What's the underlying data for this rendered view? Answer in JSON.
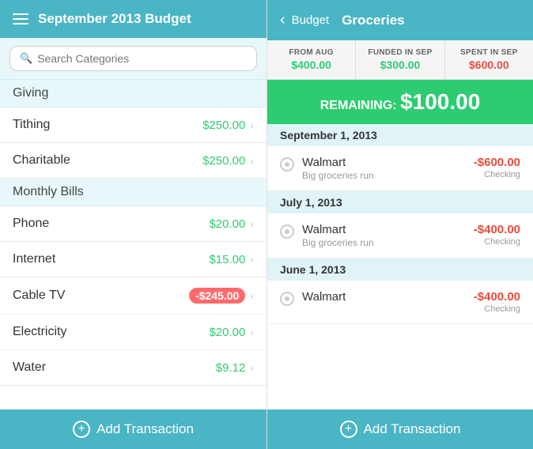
{
  "left": {
    "header": {
      "title": "September 2013 Budget"
    },
    "search": {
      "placeholder": "Search Categories"
    },
    "sections": [
      {
        "name": "Giving",
        "items": [
          {
            "label": "Tithing",
            "amount": "$250.00",
            "negative": false
          },
          {
            "label": "Charitable",
            "amount": "$250.00",
            "negative": false
          }
        ]
      },
      {
        "name": "Monthly Bills",
        "items": [
          {
            "label": "Phone",
            "amount": "$20.00",
            "negative": false
          },
          {
            "label": "Internet",
            "amount": "$15.00",
            "negative": false
          },
          {
            "label": "Cable TV",
            "amount": "-$245.00",
            "negative": true
          },
          {
            "label": "Electricity",
            "amount": "$20.00",
            "negative": false
          },
          {
            "label": "Water",
            "amount": "$9.12",
            "negative": false
          }
        ]
      }
    ],
    "footer": {
      "button_label": "Add Transaction"
    }
  },
  "right": {
    "header": {
      "back_label": "Budget",
      "title": "Groceries"
    },
    "stats": [
      {
        "label": "FROM AUG",
        "value": "$400.00",
        "type": "green"
      },
      {
        "label": "FUNDED IN SEP",
        "value": "$300.00",
        "type": "green"
      },
      {
        "label": "SPENT IN SEP",
        "value": "$600.00",
        "type": "red"
      }
    ],
    "remaining": {
      "label": "REMAINING:",
      "amount": "$100.00"
    },
    "transactions": [
      {
        "date": "September 1, 2013",
        "items": [
          {
            "name": "Walmart",
            "sub": "Big groceries run",
            "amount": "-$600.00",
            "account": "Checking"
          }
        ]
      },
      {
        "date": "July 1, 2013",
        "items": [
          {
            "name": "Walmart",
            "sub": "Big groceries run",
            "amount": "-$400.00",
            "account": "Checking"
          }
        ]
      },
      {
        "date": "June 1, 2013",
        "items": [
          {
            "name": "Walmart",
            "sub": "",
            "amount": "-$400.00",
            "account": "Checking"
          }
        ]
      }
    ],
    "footer": {
      "button_label": "Add Transaction"
    }
  },
  "icons": {
    "plus": "⊕",
    "chevron_right": "›",
    "chevron_left": "‹",
    "search": "🔍",
    "hamburger": "☰"
  }
}
